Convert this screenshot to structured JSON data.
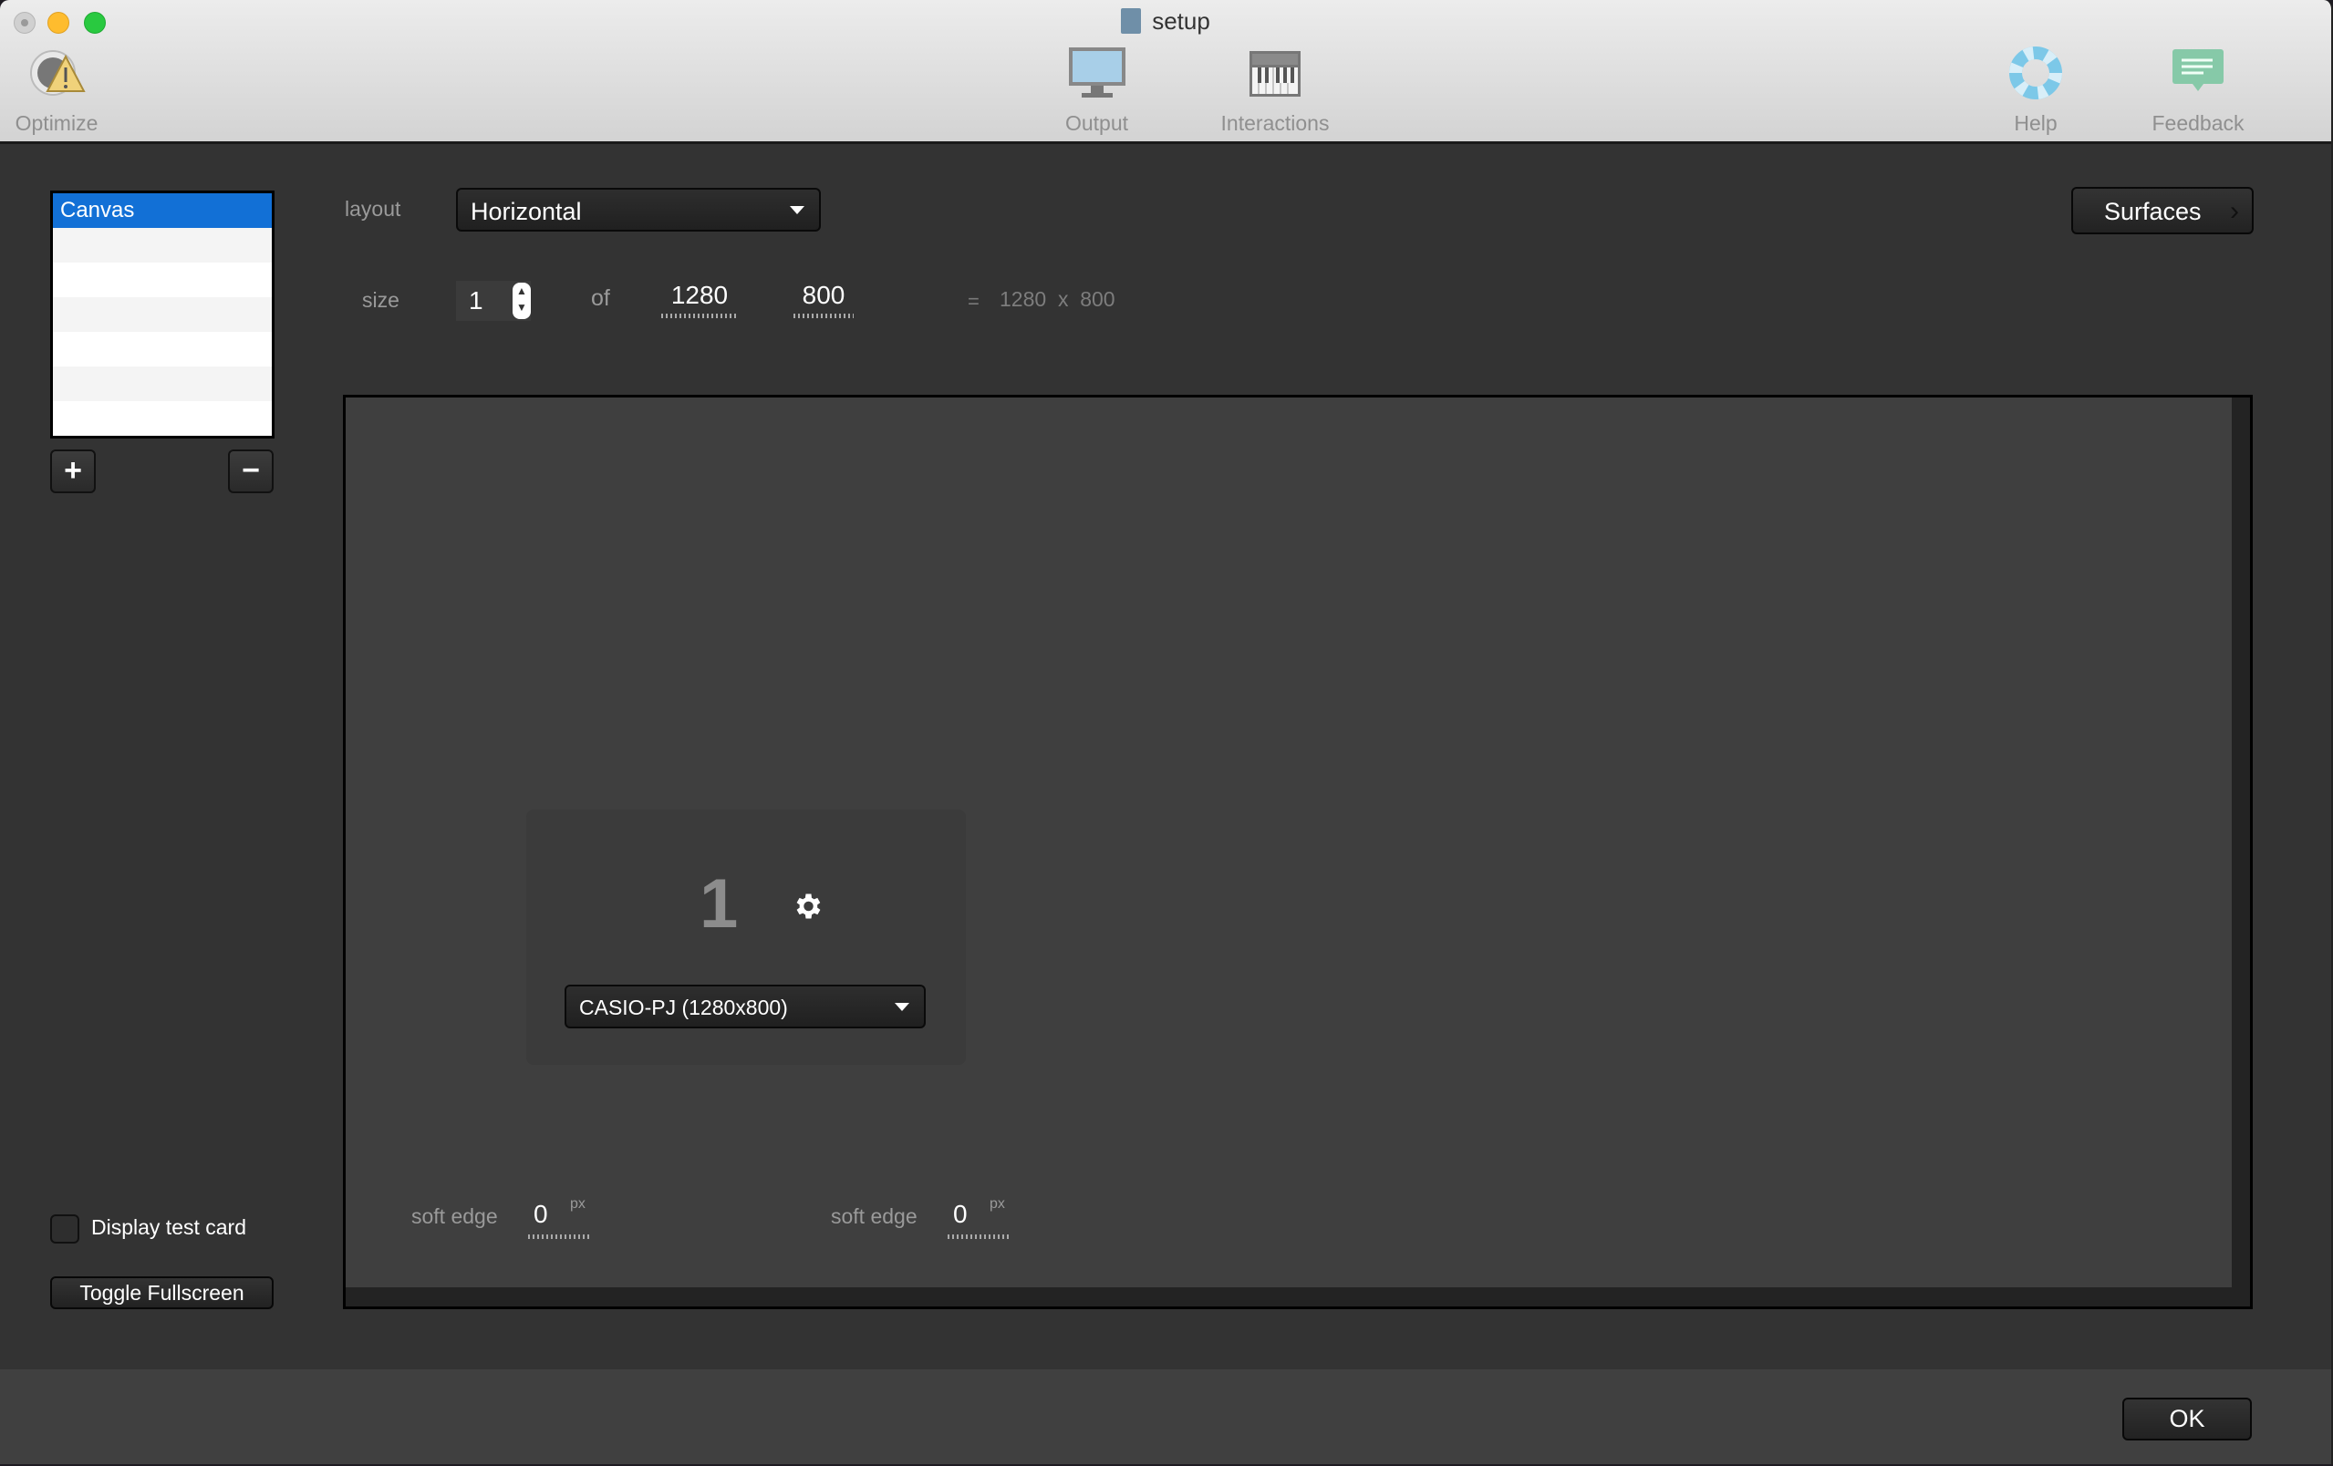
{
  "window": {
    "title": "setup",
    "traffic_lights": [
      "close",
      "minimize",
      "zoom"
    ]
  },
  "toolbar": {
    "items": [
      {
        "label": "Optimize",
        "icon": "optimize-warning-icon"
      },
      {
        "label": "Output",
        "icon": "monitor-icon"
      },
      {
        "label": "Interactions",
        "icon": "midi-keyboard-icon"
      },
      {
        "label": "Help",
        "icon": "lifebuoy-icon"
      },
      {
        "label": "Feedback",
        "icon": "speech-bubble-icon"
      }
    ]
  },
  "sidebar": {
    "list_items": [
      "Canvas"
    ],
    "selected": "Canvas",
    "add_label": "+",
    "remove_label": "−",
    "display_test_card_label": "Display test card",
    "display_test_card_checked": false,
    "toggle_fullscreen_label": "Toggle Fullscreen"
  },
  "settings": {
    "layout_label": "layout",
    "layout_value": "Horizontal",
    "size_label": "size",
    "size_count": "1",
    "of_label": "of",
    "width": "1280",
    "height": "800",
    "equals": "=",
    "result_text": "1280  x  800",
    "surfaces_label": "Surfaces"
  },
  "canvas": {
    "displays": [
      {
        "number": "1",
        "output": "CASIO-PJ (1280x800)"
      }
    ],
    "soft_edges": [
      {
        "label": "soft edge",
        "value": "0",
        "unit": "px"
      },
      {
        "label": "soft edge",
        "value": "0",
        "unit": "px"
      }
    ]
  },
  "footer": {
    "ok_label": "OK"
  },
  "colors": {
    "selection": "#1270d6",
    "background": "#333333",
    "canvas": "#3f3f3f"
  }
}
